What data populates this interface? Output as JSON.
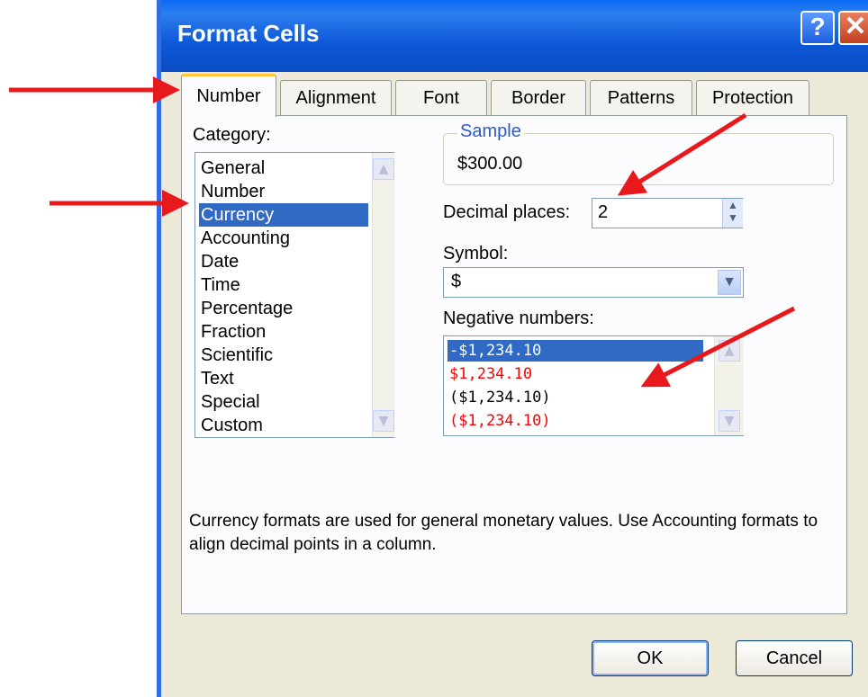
{
  "window": {
    "title": "Format Cells",
    "help_label": "?",
    "close_label": "✕"
  },
  "tabs": [
    "Number",
    "Alignment",
    "Font",
    "Border",
    "Patterns",
    "Protection"
  ],
  "active_tab": "Number",
  "category": {
    "label": "Category:",
    "items": [
      "General",
      "Number",
      "Currency",
      "Accounting",
      "Date",
      "Time",
      "Percentage",
      "Fraction",
      "Scientific",
      "Text",
      "Special",
      "Custom"
    ],
    "selected": "Currency"
  },
  "sample": {
    "label": "Sample",
    "value": "$300.00"
  },
  "decimal_places": {
    "label": "Decimal places:",
    "value": "2"
  },
  "symbol": {
    "label": "Symbol:",
    "value": "$"
  },
  "negative_numbers": {
    "label": "Negative numbers:",
    "items": [
      {
        "text": "-$1,234.10",
        "color": "#000000"
      },
      {
        "text": "$1,234.10",
        "color": "#ff0000"
      },
      {
        "text": "($1,234.10)",
        "color": "#000000"
      },
      {
        "text": "($1,234.10)",
        "color": "#ff0000"
      }
    ],
    "selected_index": 0
  },
  "description": "Currency formats are used for general monetary values.  Use Accounting formats to align decimal points in a column.",
  "buttons": {
    "ok": "OK",
    "cancel": "Cancel"
  },
  "colors": {
    "annotation_arrow": "#e8191d",
    "selection": "#316ac5",
    "titlebar": "#0a58d6"
  }
}
